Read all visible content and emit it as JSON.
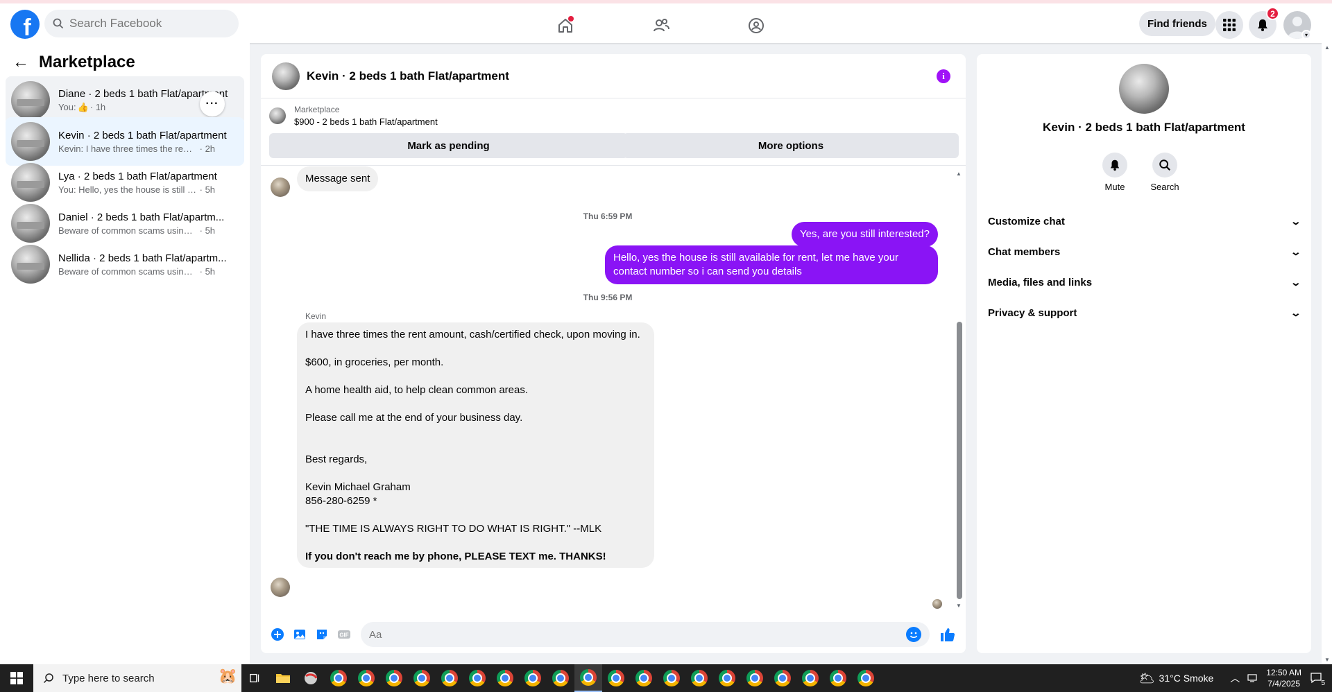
{
  "topbar": {
    "search_placeholder": "Search Facebook",
    "find_friends": "Find friends",
    "notif_count": "2"
  },
  "sidebar": {
    "title": "Marketplace",
    "conversations": [
      {
        "title": "Diane · 2 beds 1 bath Flat/apartment",
        "preview": "You: ",
        "time": "· 1h"
      },
      {
        "title": "Kevin · 2 beds 1 bath Flat/apartment",
        "preview": "Kevin: I have three times the rent amo...",
        "time": "· 2h"
      },
      {
        "title": "Lya · 2 beds 1 bath Flat/apartment",
        "preview": "You: Hello, yes the house is still availa...",
        "time": "· 5h"
      },
      {
        "title": "Daniel · 2 beds 1 bath Flat/apartm...",
        "preview": "Beware of common scams using pay...",
        "time": "· 5h"
      },
      {
        "title": "Nellida · 2 beds 1 bath Flat/apartm...",
        "preview": "Beware of common scams using pay...",
        "time": "· 5h"
      }
    ]
  },
  "chat": {
    "title": "Kevin · 2 beds 1 bath Flat/apartment",
    "marketplace_label": "Marketplace",
    "listing": "$900 - 2 beds 1 bath Flat/apartment",
    "mark_pending": "Mark as pending",
    "more_options": "More options",
    "message_sent": "Message sent",
    "ts1": "Thu 6:59 PM",
    "out1": "Yes, are you still interested?",
    "out2": "Hello, yes the house is still available for rent, let me have your contact number so i can send you details",
    "ts2": "Thu 9:56 PM",
    "sender": "Kevin",
    "long_msg": {
      "l1": "I have three times the rent amount, cash/certified check, upon moving in.",
      "l2": "$600, in groceries, per month.",
      "l3": "A home health aid, to help clean common areas.",
      "l4": "Please call me at the end of your business day.",
      "l5": "Best regards,",
      "l6": "Kevin Michael Graham",
      "l7": "856-280-6259 *",
      "l8": "\"THE TIME IS ALWAYS RIGHT TO DO WHAT IS RIGHT.\"  --MLK",
      "l9": "If you don't reach me by phone, PLEASE TEXT me.  THANKS!"
    },
    "composer_placeholder": "Aa"
  },
  "rpanel": {
    "title": "Kevin · 2 beds 1 bath Flat/apartment",
    "mute": "Mute",
    "search": "Search",
    "rows": [
      "Customize chat",
      "Chat members",
      "Media, files and links",
      "Privacy & support"
    ]
  },
  "taskbar": {
    "search_placeholder": "Type here to search",
    "weather": "31°C  Smoke",
    "time": "12:50 AM",
    "date": "7/4/2025",
    "notif": "5"
  },
  "colors": {
    "brand": "#1877f2",
    "outgoing_bubble": "#8a14f5",
    "badge": "#e41e3f"
  }
}
